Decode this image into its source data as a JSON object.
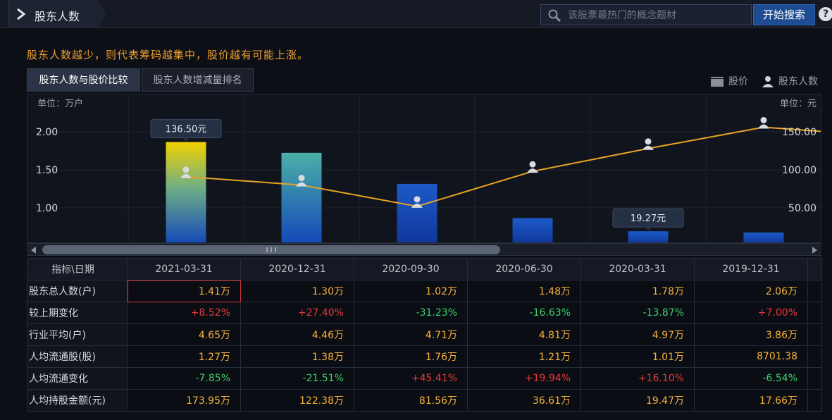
{
  "header": {
    "title": "股东人数",
    "search_placeholder": "该股票最热门的概念题材",
    "search_button": "开始搜索",
    "help": "?"
  },
  "notice": "股东人数越少，则代表筹码越集中，股价越有可能上涨。",
  "tabs": [
    {
      "label": "股东人数与股价比较",
      "active": true
    },
    {
      "label": "股东人数增减量排名",
      "active": false
    }
  ],
  "legend": {
    "price": "股价",
    "holders": "股东人数"
  },
  "chart_data": {
    "type": "bar",
    "left_unit": "单位：万户",
    "right_unit": "单位：元",
    "left_ticks": [
      "2.00",
      "1.50",
      "1.00"
    ],
    "right_ticks": [
      "150.00",
      "100.00",
      "50.00"
    ],
    "categories": [
      "2021-03-31",
      "2020-12-31",
      "2020-09-30",
      "2020-06-30",
      "2020-03-31",
      "2019-12-31"
    ],
    "holders_wan": [
      1.41,
      1.3,
      1.02,
      1.48,
      1.78,
      2.06
    ],
    "price_yuan": [
      136.5,
      122.38,
      81.56,
      36.61,
      19.27,
      17.66
    ],
    "tooltips": [
      "136.50元",
      "19.27元"
    ],
    "colors": {
      "line": "#e8a322",
      "bar_top_highlight": "#f2d200",
      "bar_blue": "#1448b8"
    }
  },
  "table": {
    "header": [
      "指标\\日期",
      "2021-03-31",
      "2020-12-31",
      "2020-09-30",
      "2020-06-30",
      "2020-03-31",
      "2019-12-31"
    ],
    "rows": [
      {
        "label": "股东总人数(户)",
        "cells": [
          [
            "1.41万",
            "orange"
          ],
          [
            "1.30万",
            "orange"
          ],
          [
            "1.02万",
            "orange"
          ],
          [
            "1.48万",
            "orange"
          ],
          [
            "1.78万",
            "orange"
          ],
          [
            "2.06万",
            "orange"
          ]
        ]
      },
      {
        "label": "较上期变化",
        "cells": [
          [
            "+8.52%",
            "red"
          ],
          [
            "+27.40%",
            "red"
          ],
          [
            "-31.23%",
            "green"
          ],
          [
            "-16.63%",
            "green"
          ],
          [
            "-13.87%",
            "green"
          ],
          [
            "+7.00%",
            "red"
          ]
        ]
      },
      {
        "label": "行业平均(户)",
        "cells": [
          [
            "4.65万",
            "orange"
          ],
          [
            "4.46万",
            "orange"
          ],
          [
            "4.71万",
            "orange"
          ],
          [
            "4.81万",
            "orange"
          ],
          [
            "4.97万",
            "orange"
          ],
          [
            "3.86万",
            "orange"
          ]
        ]
      },
      {
        "label": "人均流通股(股)",
        "cells": [
          [
            "1.27万",
            "orange"
          ],
          [
            "1.38万",
            "orange"
          ],
          [
            "1.76万",
            "orange"
          ],
          [
            "1.21万",
            "orange"
          ],
          [
            "1.01万",
            "orange"
          ],
          [
            "8701.38",
            "orange"
          ]
        ]
      },
      {
        "label": "人均流通变化",
        "cells": [
          [
            "-7.85%",
            "green"
          ],
          [
            "-21.51%",
            "green"
          ],
          [
            "+45.41%",
            "red"
          ],
          [
            "+19.94%",
            "red"
          ],
          [
            "+16.10%",
            "red"
          ],
          [
            "-6.54%",
            "green"
          ]
        ]
      },
      {
        "label": "人均持股金额(元)",
        "cells": [
          [
            "173.95万",
            "orange"
          ],
          [
            "122.38万",
            "orange"
          ],
          [
            "81.56万",
            "orange"
          ],
          [
            "36.61万",
            "orange"
          ],
          [
            "19.47万",
            "orange"
          ],
          [
            "17.66万",
            "orange"
          ]
        ]
      }
    ]
  }
}
